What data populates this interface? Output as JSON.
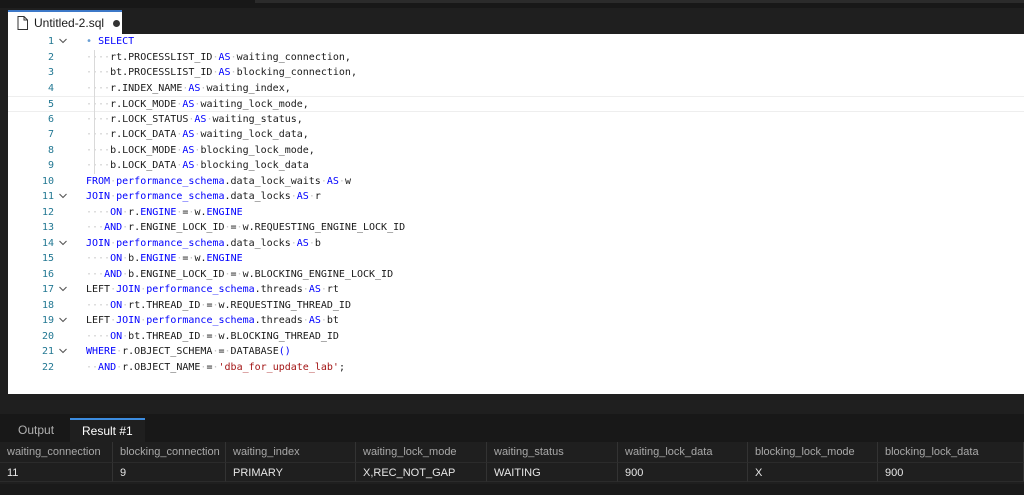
{
  "tab": {
    "title": "Untitled-2.sql"
  },
  "editor": {
    "lines": [
      {
        "n": "1",
        "foldable": true,
        "tokens": [
          [
            "bullet",
            "•"
          ],
          [
            "ws",
            " "
          ],
          [
            "kw",
            "SELECT"
          ]
        ]
      },
      {
        "n": "2",
        "foldable": false,
        "tokens": [
          [
            "ws",
            "····"
          ],
          [
            "t",
            "rt.PROCESSLIST_ID"
          ],
          [
            "ws",
            "·"
          ],
          [
            "kw",
            "AS"
          ],
          [
            "ws",
            "·"
          ],
          [
            "t",
            "waiting_connection,"
          ]
        ]
      },
      {
        "n": "3",
        "foldable": false,
        "tokens": [
          [
            "ws",
            "····"
          ],
          [
            "t",
            "bt.PROCESSLIST_ID"
          ],
          [
            "ws",
            "·"
          ],
          [
            "kw",
            "AS"
          ],
          [
            "ws",
            "·"
          ],
          [
            "t",
            "blocking_connection,"
          ]
        ]
      },
      {
        "n": "4",
        "foldable": false,
        "tokens": [
          [
            "ws",
            "····"
          ],
          [
            "t",
            "r.INDEX_NAME"
          ],
          [
            "ws",
            "·"
          ],
          [
            "kw",
            "AS"
          ],
          [
            "ws",
            "·"
          ],
          [
            "t",
            "waiting_index,"
          ]
        ]
      },
      {
        "n": "5",
        "foldable": false,
        "tokens": [
          [
            "ws",
            "····"
          ],
          [
            "t",
            "r.LOCK_MODE"
          ],
          [
            "ws",
            "·"
          ],
          [
            "kw",
            "AS"
          ],
          [
            "ws",
            "·"
          ],
          [
            "t",
            "waiting_lock_mode,"
          ]
        ]
      },
      {
        "n": "6",
        "foldable": false,
        "tokens": [
          [
            "ws",
            "····"
          ],
          [
            "t",
            "r.LOCK_STATUS"
          ],
          [
            "ws",
            "·"
          ],
          [
            "kw",
            "AS"
          ],
          [
            "ws",
            "·"
          ],
          [
            "t",
            "waiting_status,"
          ]
        ]
      },
      {
        "n": "7",
        "foldable": false,
        "tokens": [
          [
            "ws",
            "····"
          ],
          [
            "t",
            "r.LOCK_DATA"
          ],
          [
            "ws",
            "·"
          ],
          [
            "kw",
            "AS"
          ],
          [
            "ws",
            "·"
          ],
          [
            "t",
            "waiting_lock_data,"
          ]
        ]
      },
      {
        "n": "8",
        "foldable": false,
        "tokens": [
          [
            "ws",
            "····"
          ],
          [
            "t",
            "b.LOCK_MODE"
          ],
          [
            "ws",
            "·"
          ],
          [
            "kw",
            "AS"
          ],
          [
            "ws",
            "·"
          ],
          [
            "t",
            "blocking_lock_mode,"
          ]
        ]
      },
      {
        "n": "9",
        "foldable": false,
        "tokens": [
          [
            "ws",
            "····"
          ],
          [
            "t",
            "b.LOCK_DATA"
          ],
          [
            "ws",
            "·"
          ],
          [
            "kw",
            "AS"
          ],
          [
            "ws",
            "·"
          ],
          [
            "t",
            "blocking_lock_data"
          ]
        ]
      },
      {
        "n": "10",
        "foldable": false,
        "tokens": [
          [
            "kw",
            "FROM"
          ],
          [
            "ws",
            "·"
          ],
          [
            "kw",
            "performance_schema"
          ],
          [
            "t",
            ".data_lock_waits"
          ],
          [
            "ws",
            "·"
          ],
          [
            "kw",
            "AS"
          ],
          [
            "ws",
            "·"
          ],
          [
            "t",
            "w"
          ]
        ]
      },
      {
        "n": "11",
        "foldable": true,
        "tokens": [
          [
            "kw",
            "JOIN"
          ],
          [
            "ws",
            "·"
          ],
          [
            "kw",
            "performance_schema"
          ],
          [
            "t",
            ".data_locks"
          ],
          [
            "ws",
            "·"
          ],
          [
            "kw",
            "AS"
          ],
          [
            "ws",
            "·"
          ],
          [
            "t",
            "r"
          ]
        ]
      },
      {
        "n": "12",
        "foldable": false,
        "tokens": [
          [
            "ws",
            "····"
          ],
          [
            "kw",
            "ON"
          ],
          [
            "ws",
            "·"
          ],
          [
            "t",
            "r."
          ],
          [
            "kw",
            "ENGINE"
          ],
          [
            "ws",
            "·"
          ],
          [
            "t",
            "="
          ],
          [
            "ws",
            "·"
          ],
          [
            "t",
            "w."
          ],
          [
            "kw",
            "ENGINE"
          ]
        ]
      },
      {
        "n": "13",
        "foldable": false,
        "tokens": [
          [
            "ws",
            "···"
          ],
          [
            "kw",
            "AND"
          ],
          [
            "ws",
            "·"
          ],
          [
            "t",
            "r.ENGINE_LOCK_ID"
          ],
          [
            "ws",
            "·"
          ],
          [
            "t",
            "="
          ],
          [
            "ws",
            "·"
          ],
          [
            "t",
            "w.REQUESTING_ENGINE_LOCK_ID"
          ]
        ]
      },
      {
        "n": "14",
        "foldable": true,
        "tokens": [
          [
            "kw",
            "JOIN"
          ],
          [
            "ws",
            "·"
          ],
          [
            "kw",
            "performance_schema"
          ],
          [
            "t",
            ".data_locks"
          ],
          [
            "ws",
            "·"
          ],
          [
            "kw",
            "AS"
          ],
          [
            "ws",
            "·"
          ],
          [
            "t",
            "b"
          ]
        ]
      },
      {
        "n": "15",
        "foldable": false,
        "tokens": [
          [
            "ws",
            "····"
          ],
          [
            "kw",
            "ON"
          ],
          [
            "ws",
            "·"
          ],
          [
            "t",
            "b."
          ],
          [
            "kw",
            "ENGINE"
          ],
          [
            "ws",
            "·"
          ],
          [
            "t",
            "="
          ],
          [
            "ws",
            "·"
          ],
          [
            "t",
            "w."
          ],
          [
            "kw",
            "ENGINE"
          ]
        ]
      },
      {
        "n": "16",
        "foldable": false,
        "tokens": [
          [
            "ws",
            "···"
          ],
          [
            "kw",
            "AND"
          ],
          [
            "ws",
            "·"
          ],
          [
            "t",
            "b.ENGINE_LOCK_ID"
          ],
          [
            "ws",
            "·"
          ],
          [
            "t",
            "="
          ],
          [
            "ws",
            "·"
          ],
          [
            "t",
            "w.BLOCKING_ENGINE_LOCK_ID"
          ]
        ]
      },
      {
        "n": "17",
        "foldable": true,
        "tokens": [
          [
            "t",
            "LEFT"
          ],
          [
            "ws",
            "·"
          ],
          [
            "kw",
            "JOIN"
          ],
          [
            "ws",
            "·"
          ],
          [
            "kw",
            "performance_schema"
          ],
          [
            "t",
            ".threads"
          ],
          [
            "ws",
            "·"
          ],
          [
            "kw",
            "AS"
          ],
          [
            "ws",
            "·"
          ],
          [
            "t",
            "rt"
          ]
        ]
      },
      {
        "n": "18",
        "foldable": false,
        "tokens": [
          [
            "ws",
            "····"
          ],
          [
            "kw",
            "ON"
          ],
          [
            "ws",
            "·"
          ],
          [
            "t",
            "rt.THREAD_ID"
          ],
          [
            "ws",
            "·"
          ],
          [
            "t",
            "="
          ],
          [
            "ws",
            "·"
          ],
          [
            "t",
            "w.REQUESTING_THREAD_ID"
          ]
        ]
      },
      {
        "n": "19",
        "foldable": true,
        "tokens": [
          [
            "t",
            "LEFT"
          ],
          [
            "ws",
            "·"
          ],
          [
            "kw",
            "JOIN"
          ],
          [
            "ws",
            "·"
          ],
          [
            "kw",
            "performance_schema"
          ],
          [
            "t",
            ".threads"
          ],
          [
            "ws",
            "·"
          ],
          [
            "kw",
            "AS"
          ],
          [
            "ws",
            "·"
          ],
          [
            "t",
            "bt"
          ]
        ]
      },
      {
        "n": "20",
        "foldable": false,
        "tokens": [
          [
            "ws",
            "····"
          ],
          [
            "kw",
            "ON"
          ],
          [
            "ws",
            "·"
          ],
          [
            "t",
            "bt.THREAD_ID"
          ],
          [
            "ws",
            "·"
          ],
          [
            "t",
            "="
          ],
          [
            "ws",
            "·"
          ],
          [
            "t",
            "w.BLOCKING_THREAD_ID"
          ]
        ]
      },
      {
        "n": "21",
        "foldable": true,
        "tokens": [
          [
            "kw",
            "WHERE"
          ],
          [
            "ws",
            "·"
          ],
          [
            "t",
            "r.OBJECT_SCHEMA"
          ],
          [
            "ws",
            "·"
          ],
          [
            "t",
            "="
          ],
          [
            "ws",
            "·"
          ],
          [
            "t",
            "DATABASE"
          ],
          [
            "kw",
            "()"
          ]
        ]
      },
      {
        "n": "22",
        "foldable": false,
        "tokens": [
          [
            "ws",
            "··"
          ],
          [
            "kw",
            "AND"
          ],
          [
            "ws",
            "·"
          ],
          [
            "t",
            "r.OBJECT_NAME"
          ],
          [
            "ws",
            "·"
          ],
          [
            "t",
            "="
          ],
          [
            "ws",
            "·"
          ],
          [
            "str",
            "'dba_for_update_lab'"
          ],
          [
            "t",
            ";"
          ]
        ]
      }
    ]
  },
  "panel": {
    "tabs": [
      "Output",
      "Result #1"
    ],
    "columns": [
      "waiting_connection",
      "blocking_connection",
      "waiting_index",
      "waiting_lock_mode",
      "waiting_status",
      "waiting_lock_data",
      "blocking_lock_mode",
      "blocking_lock_data"
    ],
    "rows": [
      [
        "11",
        "9",
        "PRIMARY",
        "X,REC_NOT_GAP",
        "WAITING",
        "900",
        "X",
        "900"
      ]
    ]
  },
  "colors": {
    "keyword": "#0000ff",
    "string": "#a31515",
    "line_number": "#237893",
    "tab_accent": "#3c8ce0"
  }
}
